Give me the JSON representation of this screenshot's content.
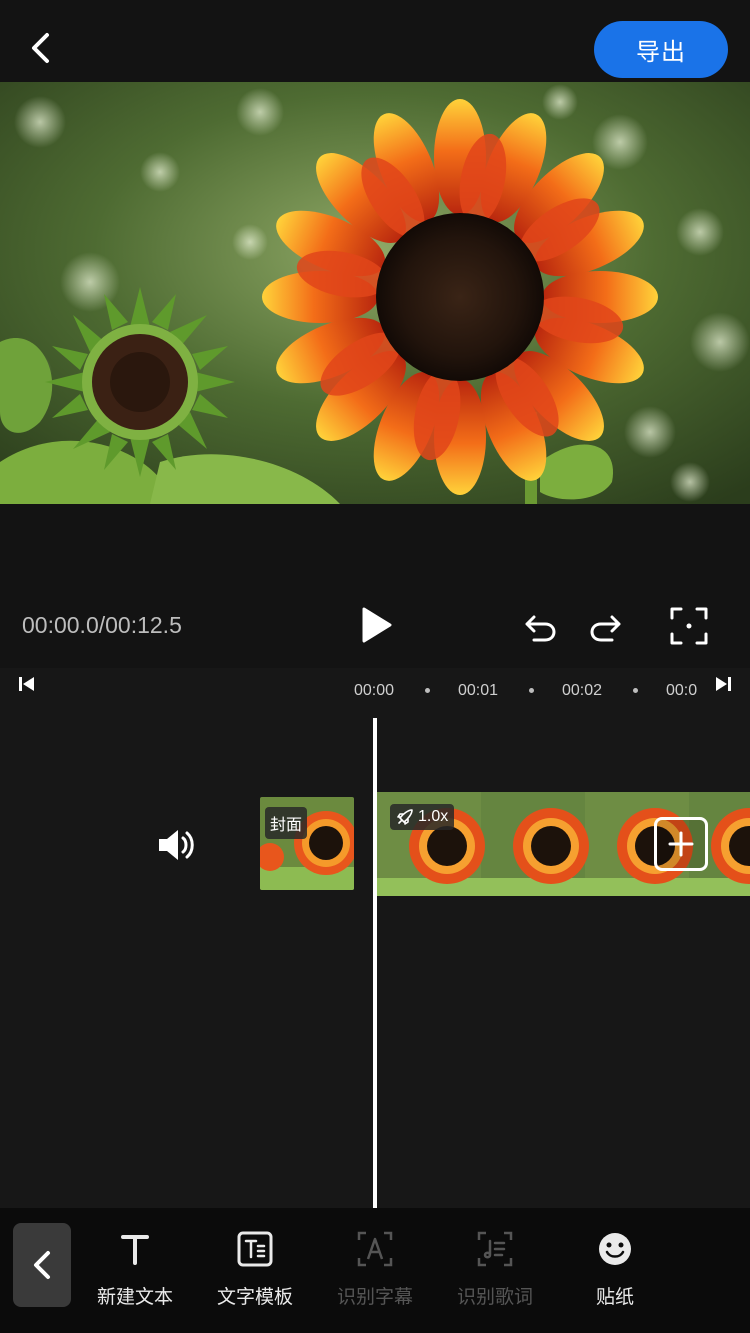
{
  "header": {
    "export_label": "导出"
  },
  "player": {
    "time": "00:00.0/00:12.5"
  },
  "timeline": {
    "ticks": [
      "00:00",
      "00:01",
      "00:02",
      "00:0"
    ],
    "cover_label": "封面",
    "speed": "1.0x"
  },
  "toolbar": {
    "items": [
      {
        "label": "新建文本",
        "icon": "text-T-icon",
        "enabled": true
      },
      {
        "label": "文字模板",
        "icon": "text-template-icon",
        "enabled": true
      },
      {
        "label": "识别字幕",
        "icon": "recognize-subtitle-icon",
        "enabled": false
      },
      {
        "label": "识别歌词",
        "icon": "recognize-lyrics-icon",
        "enabled": false
      },
      {
        "label": "贴纸",
        "icon": "sticker-smiley-icon",
        "enabled": true
      }
    ]
  },
  "colors": {
    "accent": "#1a73e8",
    "background": "#131313"
  }
}
